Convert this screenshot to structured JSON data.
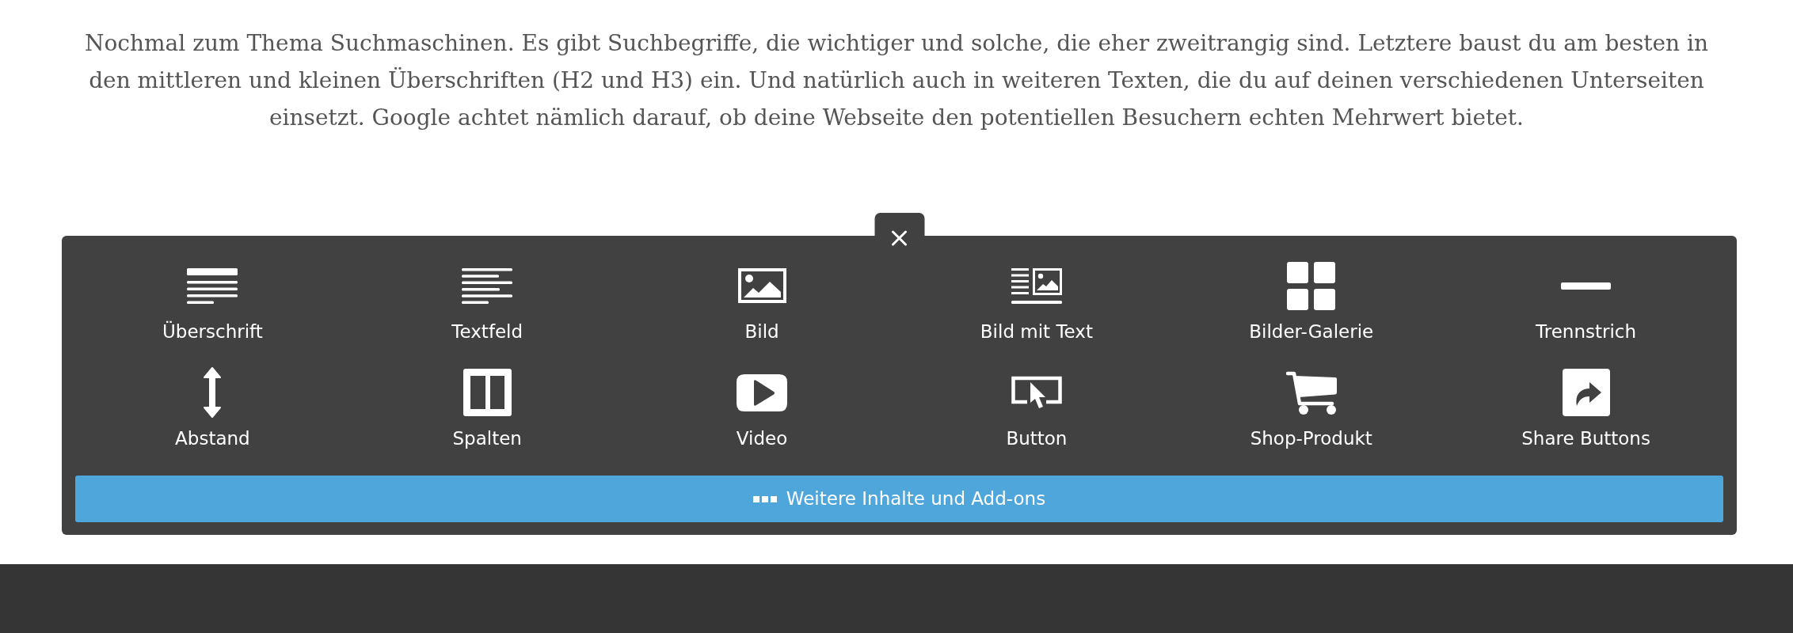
{
  "paragraph": "Nochmal zum Thema Suchmaschinen. Es gibt Suchbegriffe, die wichtiger und solche, die eher zweitrangig sind. Letztere baust du am besten in den mittleren und kleinen Überschriften (H2 und H3) ein. Und natürlich auch in weiteren Texten, die du auf deinen verschiedenen Unterseiten einsetzt. Google achtet nämlich darauf, ob deine Webseite den potentiellen Besuchern echten Mehrwert bietet.",
  "panel": {
    "elements": [
      {
        "kind": "heading",
        "label": "Überschrift"
      },
      {
        "kind": "textfield",
        "label": "Textfeld"
      },
      {
        "kind": "image",
        "label": "Bild"
      },
      {
        "kind": "imagetext",
        "label": "Bild mit Text"
      },
      {
        "kind": "gallery",
        "label": "Bilder-Galerie"
      },
      {
        "kind": "divider",
        "label": "Trennstrich"
      },
      {
        "kind": "spacing",
        "label": "Abstand"
      },
      {
        "kind": "columns",
        "label": "Spalten"
      },
      {
        "kind": "video",
        "label": "Video"
      },
      {
        "kind": "button",
        "label": "Button"
      },
      {
        "kind": "product",
        "label": "Shop-Produkt"
      },
      {
        "kind": "share",
        "label": "Share Buttons"
      }
    ],
    "more_button": {
      "label": "Weitere Inhalte und Add-ons"
    }
  }
}
